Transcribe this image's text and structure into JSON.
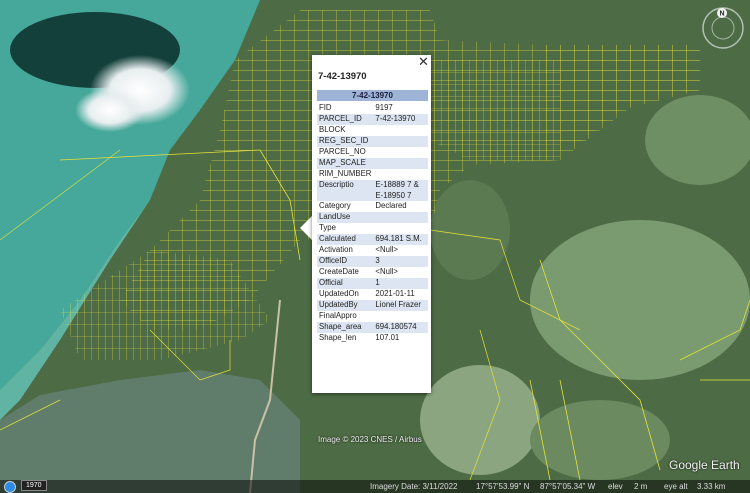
{
  "popup": {
    "title": "7-42-13970",
    "close_glyph": "✕",
    "header": "7-42-13970",
    "attributes": [
      {
        "key": "FID",
        "value": "9197"
      },
      {
        "key": "PARCEL_ID",
        "value": "7-42-13970"
      },
      {
        "key": "BLOCK",
        "value": ""
      },
      {
        "key": "REG_SEC_ID",
        "value": ""
      },
      {
        "key": "PARCEL_NO",
        "value": ""
      },
      {
        "key": "MAP_SCALE",
        "value": ""
      },
      {
        "key": "RIM_NUMBER",
        "value": ""
      },
      {
        "key": "Descriptio",
        "value": "E-18889 7 & E-18950 7"
      },
      {
        "key": "Category",
        "value": "Declared"
      },
      {
        "key": "LandUse",
        "value": ""
      },
      {
        "key": "Type",
        "value": ""
      },
      {
        "key": "Calculated",
        "value": "694.181 S.M."
      },
      {
        "key": "Activation",
        "value": "<Null>"
      },
      {
        "key": "OfficeID",
        "value": "3"
      },
      {
        "key": "CreateDate",
        "value": "<Null>"
      },
      {
        "key": "Official",
        "value": "1"
      },
      {
        "key": "UpdatedOn",
        "value": "2021-01-11"
      },
      {
        "key": "UpdatedBy",
        "value": "Lionel Frazer"
      },
      {
        "key": "FinalAppro",
        "value": ""
      },
      {
        "key": "Shape_area",
        "value": "694.180574"
      },
      {
        "key": "Shape_len",
        "value": "107.01"
      }
    ]
  },
  "map": {
    "attribution": "Image © 2023 CNES / Airbus",
    "logo": "Google Earth",
    "compass_label": "N"
  },
  "status": {
    "historical_year": "1970",
    "imagery_date": "Imagery Date: 3/11/2022",
    "latitude": "17°57'53.99\" N",
    "longitude": "87°57'05.34\" W",
    "elev_label": "elev",
    "elev_value": "2 m",
    "eye_alt_label": "eye alt",
    "eye_alt_value": "3.33 km"
  },
  "colors": {
    "parcel_lines": "#e6e23a",
    "water": "#46a89a",
    "land": "#4d6b44",
    "popup_header": "#9db4d6"
  }
}
